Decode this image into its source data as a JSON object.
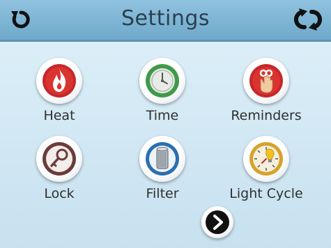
{
  "header": {
    "title": "Settings",
    "back_icon": "back-icon",
    "refresh_icon": "refresh-icon",
    "color": "#7fb6d6"
  },
  "tiles": [
    {
      "label": "Heat",
      "icon": "flame-icon",
      "color": "#c8262a"
    },
    {
      "label": "Time",
      "icon": "clock-icon",
      "color": "#3f9a4a"
    },
    {
      "label": "Reminders",
      "icon": "reminder-hand-icon",
      "color": "#c8262a"
    },
    {
      "label": "Lock",
      "icon": "key-icon",
      "color": "#6b3c3a"
    },
    {
      "label": "Filter",
      "icon": "filter-cartridge-icon",
      "color": "#2a6fb0"
    },
    {
      "label": "Light Cycle",
      "icon": "light-cycle-icon",
      "color": "#d6a22a"
    }
  ],
  "navigation": {
    "next_icon": "chevron-right-icon"
  }
}
